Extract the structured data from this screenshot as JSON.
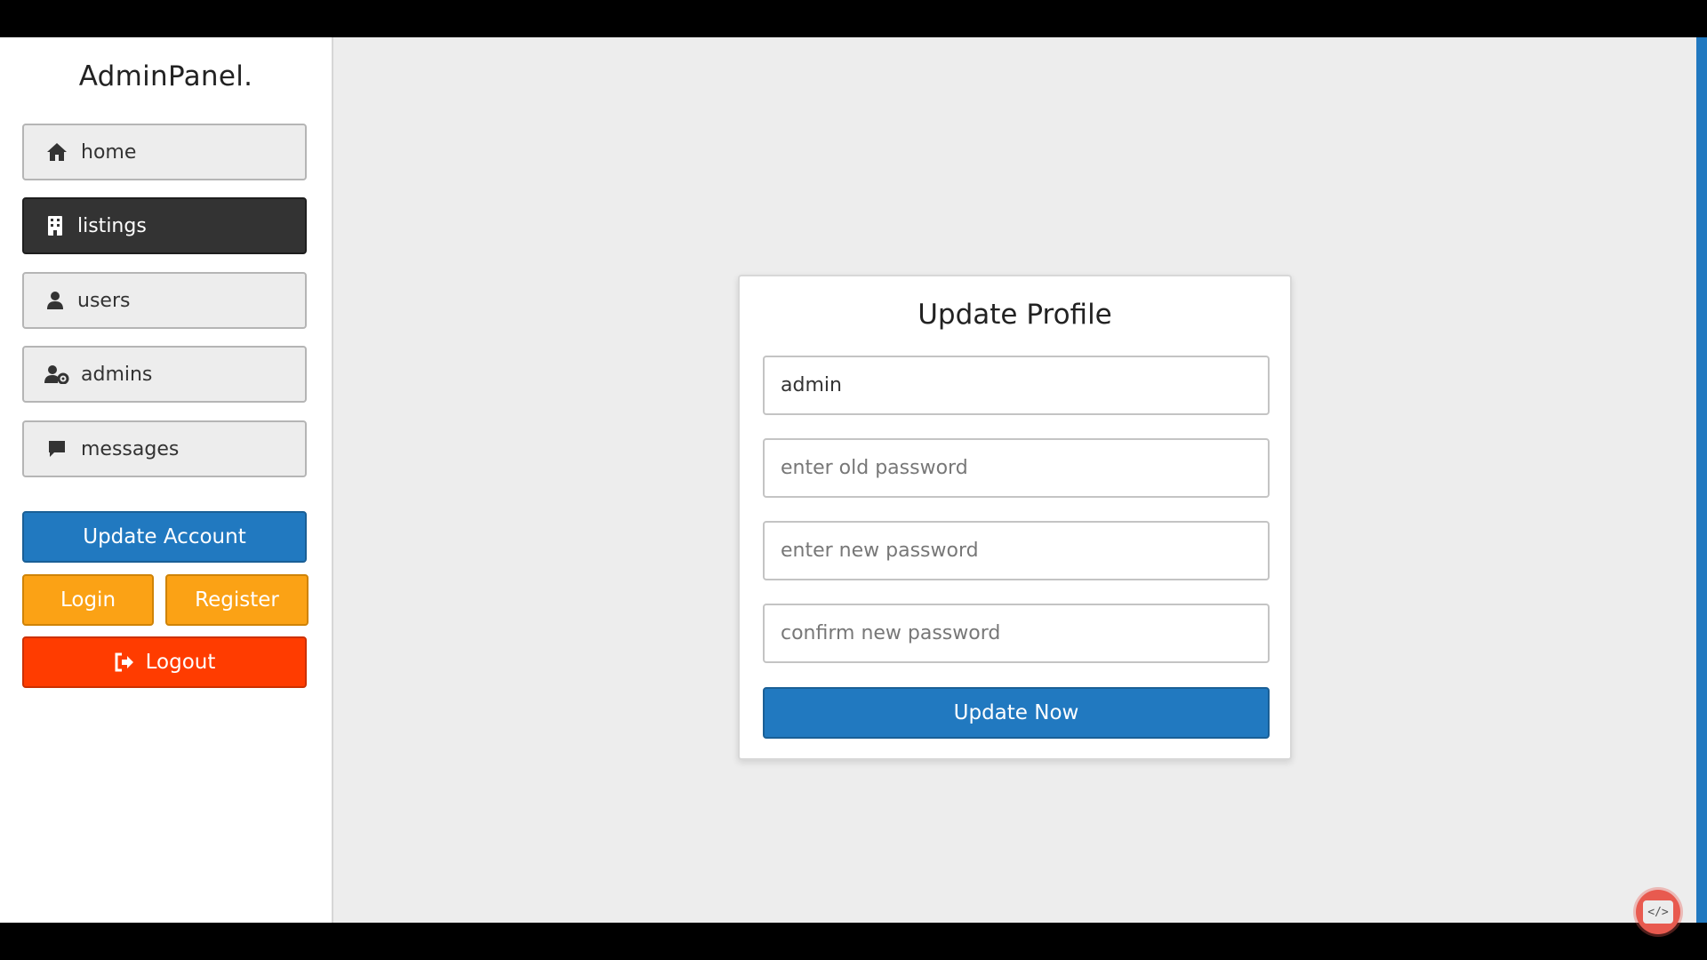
{
  "sidebar": {
    "brand": "AdminPanel.",
    "items": [
      {
        "label": "home",
        "icon": "home-icon",
        "active": false
      },
      {
        "label": "listings",
        "icon": "building-icon",
        "active": true
      },
      {
        "label": "users",
        "icon": "user-icon",
        "active": false
      },
      {
        "label": "admins",
        "icon": "user-gear-icon",
        "active": false
      },
      {
        "label": "messages",
        "icon": "comment-icon",
        "active": false
      }
    ],
    "update_account_label": "Update Account",
    "login_label": "Login",
    "register_label": "Register",
    "logout_label": "Logout",
    "logout_icon": "sign-out-icon"
  },
  "form": {
    "title": "Update Profile",
    "username_value": "admin",
    "old_password_placeholder": "enter old password",
    "new_password_placeholder": "enter new password",
    "confirm_password_placeholder": "confirm new password",
    "submit_label": "Update Now"
  },
  "widget": {
    "code_label": "</>"
  },
  "colors": {
    "primary_blue": "#2179c0",
    "orange": "#fba215",
    "red": "#ff3c00",
    "active_nav": "#333333"
  }
}
